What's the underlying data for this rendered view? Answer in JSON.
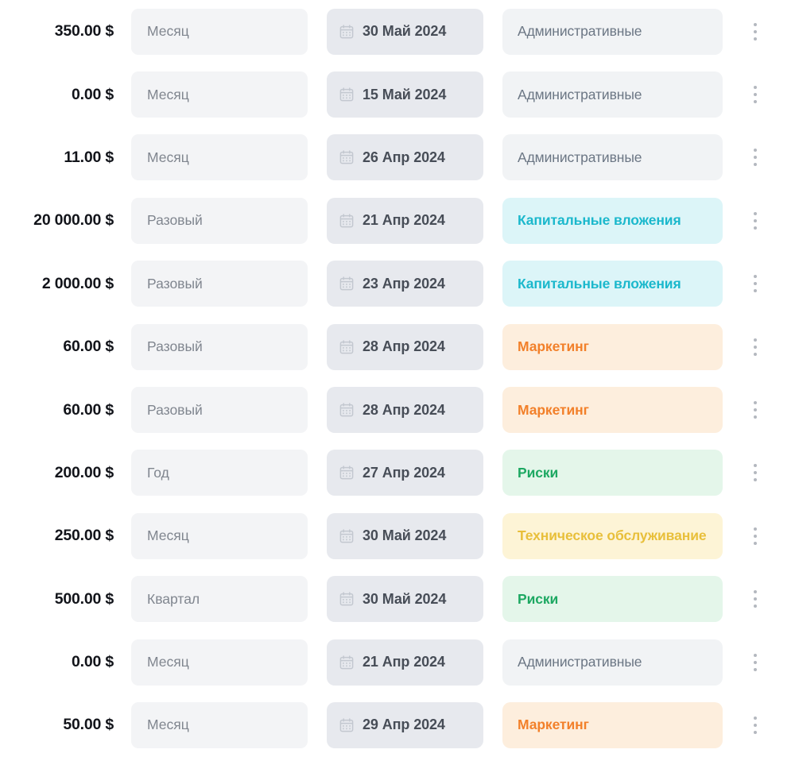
{
  "table": {
    "currency_symbol": "$",
    "columns": [
      "amount",
      "periodicity",
      "date",
      "category",
      "actions"
    ],
    "category_styles": {
      "Административные": {
        "bg": "#f1f3f5",
        "fg": "#6b7684"
      },
      "Капитальные вложения": {
        "bg": "#dcf5f8",
        "fg": "#1bb8cc"
      },
      "Маркетинг": {
        "bg": "#fdeedd",
        "fg": "#f2802a"
      },
      "Риски": {
        "bg": "#e4f6ea",
        "fg": "#1da862"
      },
      "Техническое обслуживание": {
        "bg": "#fdf4d6",
        "fg": "#e8bf3a"
      }
    },
    "icons": {
      "date": "calendar-icon",
      "actions": "kebab-menu-icon"
    },
    "rows": [
      {
        "amount": "350.00 $",
        "periodicity": "Месяц",
        "date": "30 Май 2024",
        "category": "Административные",
        "category_display": "Административные"
      },
      {
        "amount": "0.00 $",
        "periodicity": "Месяц",
        "date": "15 Май 2024",
        "category": "Административные",
        "category_display": "Административные"
      },
      {
        "amount": "11.00 $",
        "periodicity": "Месяц",
        "date": "26 Апр 2024",
        "category": "Административные",
        "category_display": "Административные"
      },
      {
        "amount": "20 000.00 $",
        "periodicity": "Разовый",
        "date": "21 Апр 2024",
        "category": "Капитальные вложения",
        "category_display": "Капитальные вложения"
      },
      {
        "amount": "2 000.00 $",
        "periodicity": "Разовый",
        "date": "23 Апр 2024",
        "category": "Капитальные вложения",
        "category_display": "Капитальные вложения"
      },
      {
        "amount": "60.00 $",
        "periodicity": "Разовый",
        "date": "28 Апр 2024",
        "category": "Маркетинг",
        "category_display": "Маркетинг"
      },
      {
        "amount": "60.00 $",
        "periodicity": "Разовый",
        "date": "28 Апр 2024",
        "category": "Маркетинг",
        "category_display": "Маркетинг"
      },
      {
        "amount": "200.00 $",
        "periodicity": "Год",
        "date": "27 Апр 2024",
        "category": "Риски",
        "category_display": "Риски"
      },
      {
        "amount": "250.00 $",
        "periodicity": "Месяц",
        "date": "30 Май 2024",
        "category": "Техническое обслуживание",
        "category_display": "Техническое обслуживание"
      },
      {
        "amount": "500.00 $",
        "periodicity": "Квартал",
        "date": "30 Май 2024",
        "category": "Риски",
        "category_display": "Риски"
      },
      {
        "amount": "0.00 $",
        "periodicity": "Месяц",
        "date": "21 Апр 2024",
        "category": "Административные",
        "category_display": "Административные"
      },
      {
        "amount": "50.00 $",
        "periodicity": "Месяц",
        "date": "29 Апр 2024",
        "category": "Маркетинг",
        "category_display": "Маркетинг"
      }
    ]
  }
}
